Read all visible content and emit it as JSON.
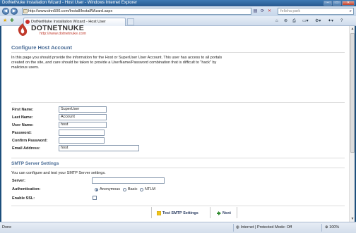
{
  "window": {
    "title": "DotNetNuke Installation Wizard - Host User - Windows Internet Explorer",
    "min_label": "–",
    "max_label": "□",
    "close_label": "✕"
  },
  "addressbar": {
    "url": "http://www.dnn500.com/Install/InstallWizard.aspx",
    "search_value": "felisha park"
  },
  "tabs": [
    {
      "label": "DotNetNuke Installation Wizard - Host User"
    }
  ],
  "logo": {
    "name": "DOTNETNUKE",
    "url": "http://www.dotnetnuke.com"
  },
  "host_section": {
    "heading": "Configure Host Account",
    "intro": "In this page you should provide the information for the Host or SuperUser User Account. This user has access to all portals created on the site, and care should be taken to provide a UserName/Password combination that is difficult to \"hack\" by malicious users."
  },
  "fields": {
    "first_name": {
      "label": "First Name:",
      "value": "SuperUser"
    },
    "last_name": {
      "label": "Last Name:",
      "value": "Account"
    },
    "user_name": {
      "label": "User Name:",
      "value": "host"
    },
    "password": {
      "label": "Password:",
      "value": ""
    },
    "confirm_password": {
      "label": "Confirm Password:",
      "value": ""
    },
    "email": {
      "label": "Email Address:",
      "value": "host"
    }
  },
  "smtp": {
    "heading": "SMTP Server Settings",
    "note": "You can configure and test your SMTP Server settings.",
    "server_label": "Server:",
    "server_value": "",
    "auth_label": "Authentication:",
    "auth_options": [
      "Anonymous",
      "Basic",
      "NTLM"
    ],
    "auth_selected": "Anonymous",
    "ssl_label": "Enable SSL:",
    "ssl_checked": false
  },
  "actions": {
    "test_smtp": "Test SMTP Settings",
    "next": "Next"
  },
  "status": {
    "text": "Done",
    "zone": "Internet | Protected Mode: Off",
    "zoom": "100%"
  }
}
